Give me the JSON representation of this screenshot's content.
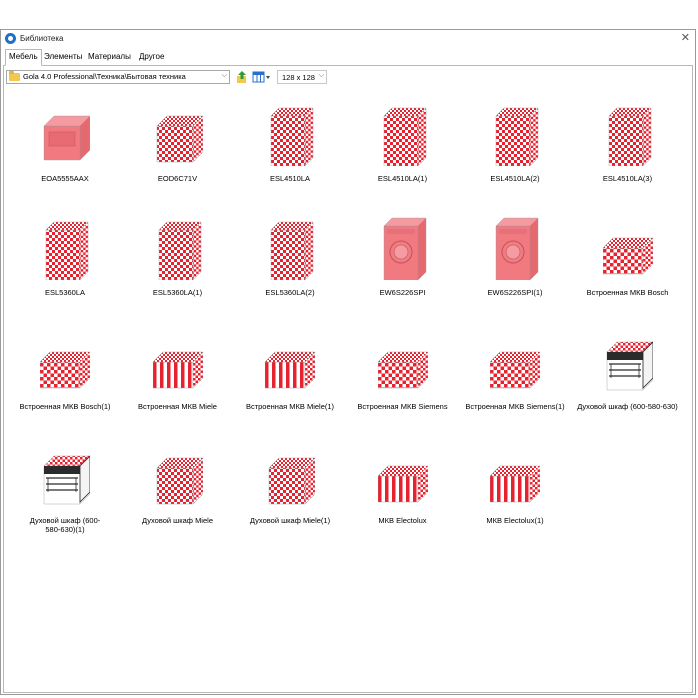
{
  "window": {
    "title": "Библиотека",
    "close_glyph": "✕"
  },
  "tabs": [
    {
      "label": "Мебель",
      "active": true
    },
    {
      "label": "Элементы",
      "active": false
    },
    {
      "label": "Материалы",
      "active": false
    },
    {
      "label": "Другое",
      "active": false
    }
  ],
  "toolbar": {
    "path": "Gola 4.0 Professional\\Техника\\Бытовая техника",
    "path_chevron": "⌵",
    "size": "128 x 128",
    "size_chevron": "⌵"
  },
  "colors": {
    "checker_red": "#e8212e",
    "solid_pink": "#f07a80",
    "dark": "#2b2b2b"
  },
  "items": [
    {
      "label": "EOA5555AAX",
      "icon": "box-solid-icon"
    },
    {
      "label": "EOD6C71V",
      "icon": "box-checker-icon"
    },
    {
      "label": "ESL4510LA",
      "icon": "tall-checker-icon"
    },
    {
      "label": "ESL4510LA(1)",
      "icon": "tall-checker-icon"
    },
    {
      "label": "ESL4510LA(2)",
      "icon": "tall-checker-icon"
    },
    {
      "label": "ESL4510LA(3)",
      "icon": "tall-checker-icon"
    },
    {
      "label": "ESL5360LA",
      "icon": "tall-checker-icon"
    },
    {
      "label": "ESL5360LA(1)",
      "icon": "tall-checker-icon"
    },
    {
      "label": "ESL5360LA(2)",
      "icon": "tall-checker-icon"
    },
    {
      "label": "EW6S226SPI",
      "icon": "washer-icon"
    },
    {
      "label": "EW6S226SPI(1)",
      "icon": "washer-icon"
    },
    {
      "label": "Встроенная МКВ Bosch",
      "icon": "wide-checker-icon"
    },
    {
      "label": "Встроенная МКВ Bosch(1)",
      "icon": "wide-checker-icon"
    },
    {
      "label": "Встроенная МКВ Miele",
      "icon": "wide-stripe-icon"
    },
    {
      "label": "Встроенная МКВ Miele(1)",
      "icon": "wide-stripe-icon"
    },
    {
      "label": "Встроенная МКВ Siemens",
      "icon": "wide-checker-icon"
    },
    {
      "label": "Встроенная МКВ Siemens(1)",
      "icon": "wide-checker-icon"
    },
    {
      "label": "Духовой шкаф (600-580-630)",
      "icon": "oven-icon"
    },
    {
      "label": "Духовой шкаф (600-580-630)(1)",
      "icon": "oven-icon"
    },
    {
      "label": "Духовой шкаф Miele",
      "icon": "box-checker-icon"
    },
    {
      "label": "Духовой шкаф Miele(1)",
      "icon": "box-checker-icon"
    },
    {
      "label": "МКВ Electolux",
      "icon": "wide-stripe-icon"
    },
    {
      "label": "МКВ Electolux(1)",
      "icon": "wide-stripe-icon"
    }
  ]
}
